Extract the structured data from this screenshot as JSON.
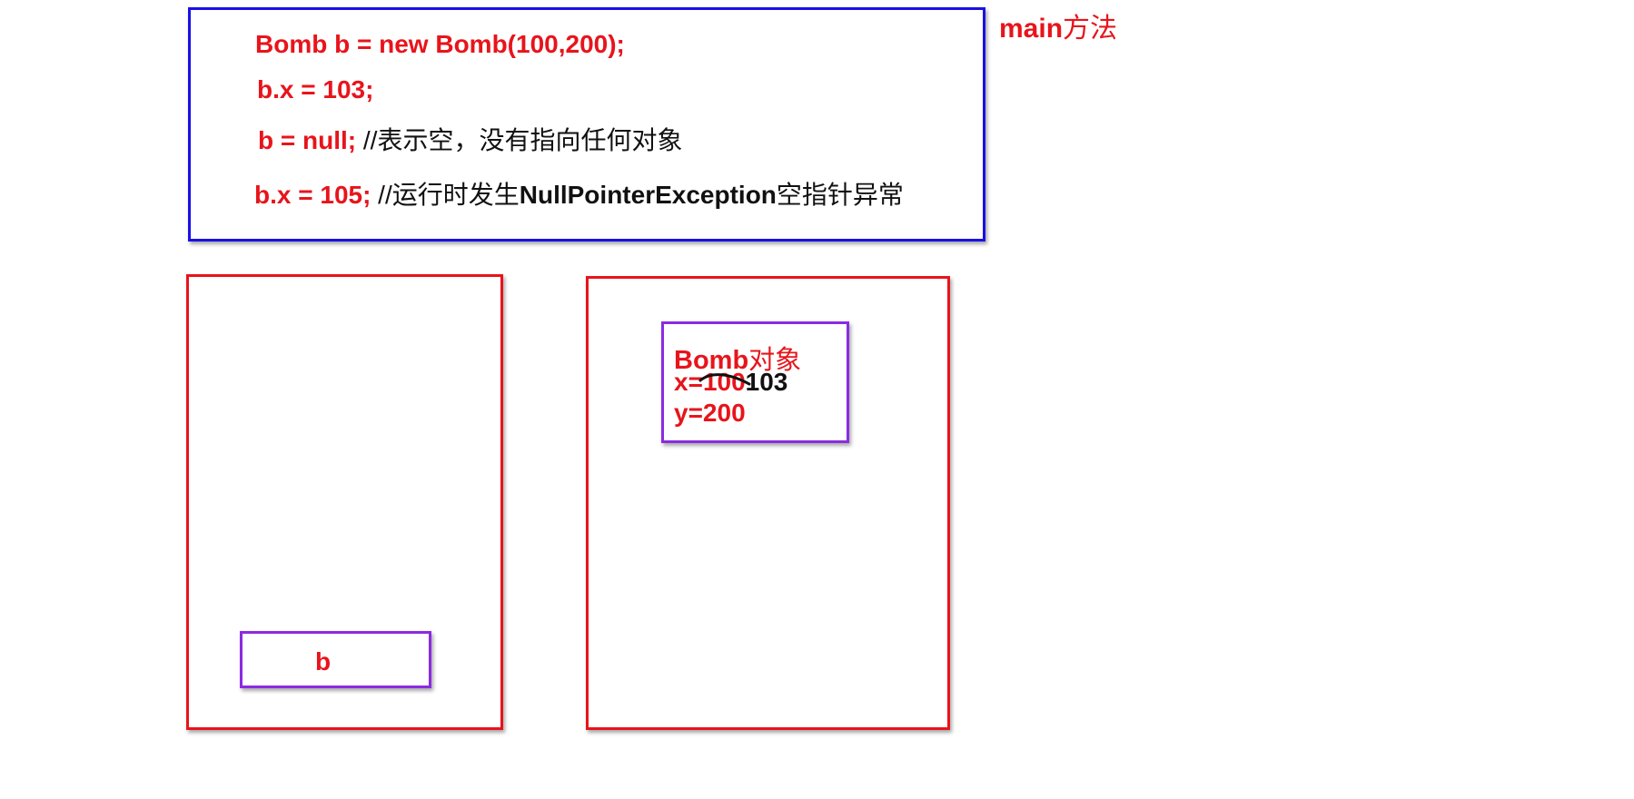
{
  "code": {
    "line1": "Bomb b = new Bomb(100,200);",
    "line2": "b.x = 103;",
    "line3_code": "b = null;",
    "line3_comment": " //表示空，没有指向任何对象",
    "line4_code": "b.x = 105;",
    "line4_comment_a": " //运行时发生",
    "line4_comment_b": "NullPointerException",
    "line4_comment_c": "空指针异常"
  },
  "method_label": {
    "word": "main",
    "suffix": "方法"
  },
  "stack": {
    "variable": "b"
  },
  "heap": {
    "object_class": "Bomb",
    "object_suffix": "对象",
    "x_label": "x=",
    "x_old": "100",
    "x_new": "103",
    "y_field": "y=200"
  },
  "colors": {
    "code_frame": "#1a10e6",
    "memory_frame": "#e8141b",
    "object_frame": "#8a2be2",
    "text_red": "#e8141b"
  }
}
